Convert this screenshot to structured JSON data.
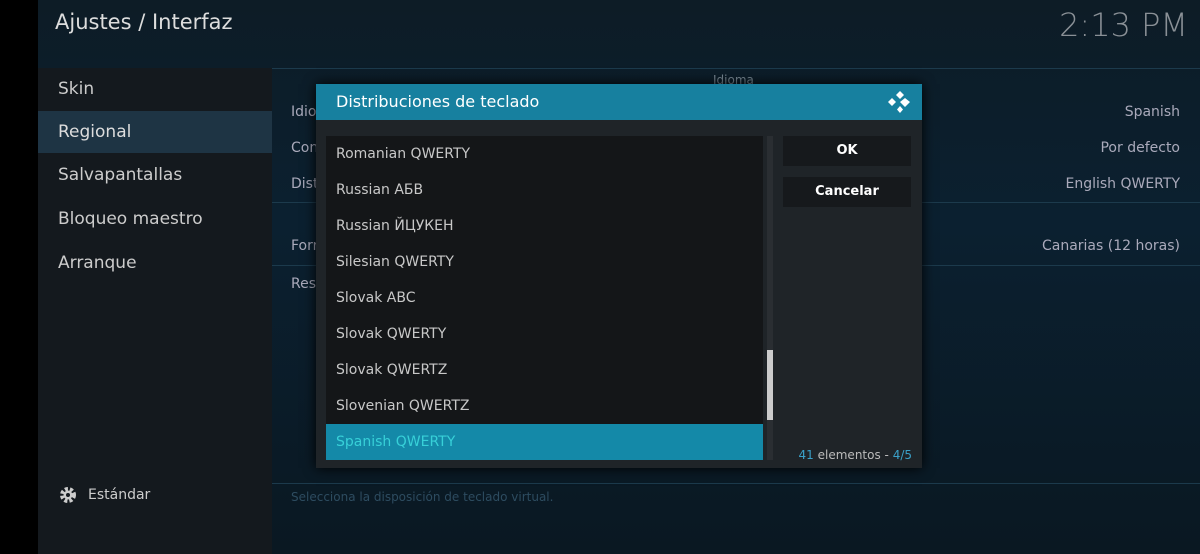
{
  "header": {
    "title": "Ajustes / Interfaz",
    "clock": "2:13 PM"
  },
  "sidebar": {
    "items": [
      {
        "label": "Skin"
      },
      {
        "label": "Regional",
        "active": true
      },
      {
        "label": "Salvapantallas"
      },
      {
        "label": "Bloqueo maestro"
      },
      {
        "label": "Arranque"
      }
    ],
    "level_label": "Estándar"
  },
  "settings": {
    "group": "Idioma",
    "rows": [
      {
        "label": "Idio",
        "value": "Spanish"
      },
      {
        "label": "Con",
        "value": "Por defecto"
      },
      {
        "label": "Dist",
        "value": "English QWERTY"
      },
      {
        "label": "Forr",
        "value": "Canarias (12 horas)"
      },
      {
        "label": "Res",
        "value": ""
      }
    ],
    "hint": "Selecciona la disposición de teclado virtual."
  },
  "dialog": {
    "title": "Distribuciones de teclado",
    "items": [
      "Romanian QWERTY",
      "Russian АБВ",
      "Russian ЙЦУКЕН",
      "Silesian QWERTY",
      "Slovak ABC",
      "Slovak QWERTY",
      "Slovak QWERTZ",
      "Slovenian QWERTZ",
      "Spanish QWERTY"
    ],
    "selected_index": 8,
    "ok": "OK",
    "cancel": "Cancelar",
    "count": "41",
    "count_label": " elementos - ",
    "page": "4/5"
  },
  "colors": {
    "accent": "#17809f",
    "selected": "#1489a8"
  }
}
